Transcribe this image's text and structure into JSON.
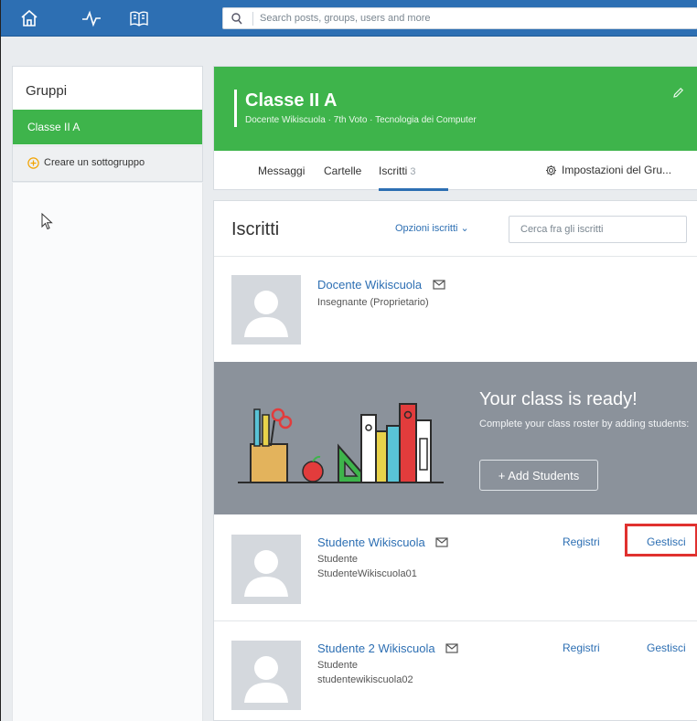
{
  "search": {
    "placeholder": "Search posts, groups, users and more"
  },
  "nav": {
    "icons": [
      "home-icon",
      "activity-icon",
      "book-icon"
    ]
  },
  "sidebar": {
    "title": "Gruppi",
    "active_item": "Classe II A",
    "create_label": "Creare un sottogruppo"
  },
  "group": {
    "name": "Classe II A",
    "subtitle": "Docente Wikiscuola · 7th Voto · Tecnologia dei Computer",
    "tabs": [
      {
        "label": "Messaggi"
      },
      {
        "label": "Cartelle"
      },
      {
        "label": "Iscritti",
        "count": "3"
      }
    ],
    "settings_label": "Impostazioni del Gru..."
  },
  "members": {
    "title": "Iscritti",
    "options_label": "Opzioni iscritti ⌄",
    "search_placeholder": "Cerca fra gli iscritti",
    "list": [
      {
        "name": "Docente Wikiscuola",
        "role": "Insegnante (Proprietario)",
        "username": ""
      },
      {
        "name": "Studente Wikiscuola",
        "role": "Studente",
        "username": "StudenteWikiscuola01",
        "registri": "Registri",
        "gestisci": "Gestisci"
      },
      {
        "name": "Studente 2 Wikiscuola",
        "role": "Studente",
        "username": "studentewikiscuola02",
        "registri": "Registri",
        "gestisci": "Gestisci"
      }
    ]
  },
  "promo": {
    "title": "Your class is ready!",
    "text": "Complete your class roster by adding students:",
    "button": "+ Add Students"
  },
  "colors": {
    "nav_blue": "#2d6fb3",
    "green": "#3eb44b",
    "promo_gray": "#8b929b",
    "highlight_red": "#e0312f"
  }
}
